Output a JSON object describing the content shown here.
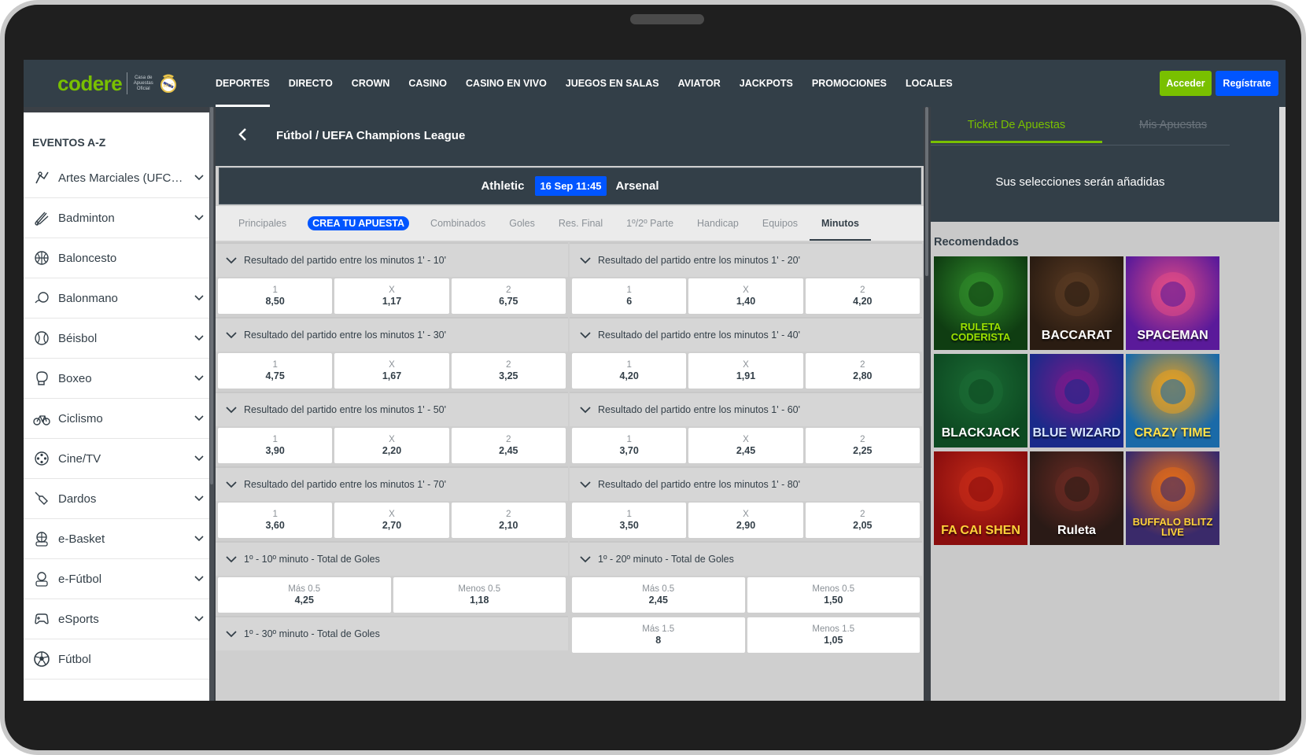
{
  "header": {
    "logo_text": "codere",
    "logo_tagline": "Casa de Apuestas Oficial",
    "nav": [
      {
        "label": "DEPORTES",
        "active": true
      },
      {
        "label": "DIRECTO"
      },
      {
        "label": "CROWN"
      },
      {
        "label": "CASINO"
      },
      {
        "label": "CASINO EN VIVO"
      },
      {
        "label": "JUEGOS EN SALAS"
      },
      {
        "label": "AVIATOR"
      },
      {
        "label": "JACKPOTS"
      },
      {
        "label": "PROMOCIONES"
      },
      {
        "label": "LOCALES"
      }
    ],
    "login_label": "Acceder",
    "register_label": "Regístrate"
  },
  "sidebar": {
    "title": "EVENTOS A-Z",
    "items": [
      {
        "label": "Artes Marciales (UFC/...",
        "icon": "martial-arts-icon"
      },
      {
        "label": "Badminton",
        "icon": "shuttlecock-icon"
      },
      {
        "label": "Baloncesto",
        "icon": "basketball-icon"
      },
      {
        "label": "Balonmano",
        "icon": "handball-icon"
      },
      {
        "label": "Béisbol",
        "icon": "baseball-icon"
      },
      {
        "label": "Boxeo",
        "icon": "boxing-glove-icon"
      },
      {
        "label": "Ciclismo",
        "icon": "bicycle-icon"
      },
      {
        "label": "Cine/TV",
        "icon": "film-reel-icon"
      },
      {
        "label": "Dardos",
        "icon": "dart-icon"
      },
      {
        "label": "e-Basket",
        "icon": "ebasket-icon"
      },
      {
        "label": "e-Fútbol",
        "icon": "efootball-icon"
      },
      {
        "label": "eSports",
        "icon": "gamepad-icon"
      },
      {
        "label": "Fútbol",
        "icon": "soccer-ball-icon"
      }
    ]
  },
  "event": {
    "breadcrumb": "Fútbol / UEFA Champions League",
    "home": "Athletic",
    "date": "16 Sep 11:45",
    "away": "Arsenal"
  },
  "tabs": [
    {
      "label": "Principales"
    },
    {
      "label": "CREA TU APUESTA",
      "pill": true
    },
    {
      "label": "Combinados"
    },
    {
      "label": "Goles"
    },
    {
      "label": "Res. Final"
    },
    {
      "label": "1º/2º Parte"
    },
    {
      "label": "Handicap"
    },
    {
      "label": "Equipos"
    },
    {
      "label": "Minutos",
      "active": true
    }
  ],
  "markets_left": [
    {
      "title": "Resultado del partido entre los minutos 1' - 10'",
      "odds": [
        [
          "1",
          "8,50"
        ],
        [
          "X",
          "1,17"
        ],
        [
          "2",
          "6,75"
        ]
      ]
    },
    {
      "title": "Resultado del partido entre los minutos 1' - 30'",
      "odds": [
        [
          "1",
          "4,75"
        ],
        [
          "X",
          "1,67"
        ],
        [
          "2",
          "3,25"
        ]
      ]
    },
    {
      "title": "Resultado del partido entre los minutos 1' - 50'",
      "odds": [
        [
          "1",
          "3,90"
        ],
        [
          "X",
          "2,20"
        ],
        [
          "2",
          "2,45"
        ]
      ]
    },
    {
      "title": "Resultado del partido entre los minutos 1' - 70'",
      "odds": [
        [
          "1",
          "3,60"
        ],
        [
          "X",
          "2,70"
        ],
        [
          "2",
          "2,10"
        ]
      ]
    },
    {
      "title": "1º - 10º minuto - Total de Goles",
      "odds": [
        [
          "Más 0.5",
          "4,25"
        ],
        [
          "Menos 0.5",
          "1,18"
        ]
      ]
    },
    {
      "title": "1º - 30º minuto - Total de Goles",
      "odds": []
    }
  ],
  "markets_right": [
    {
      "title": "Resultado del partido entre los minutos 1' - 20'",
      "odds": [
        [
          "1",
          "6"
        ],
        [
          "X",
          "1,40"
        ],
        [
          "2",
          "4,20"
        ]
      ]
    },
    {
      "title": "Resultado del partido entre los minutos 1' - 40'",
      "odds": [
        [
          "1",
          "4,20"
        ],
        [
          "X",
          "1,91"
        ],
        [
          "2",
          "2,80"
        ]
      ]
    },
    {
      "title": "Resultado del partido entre los minutos 1' - 60'",
      "odds": [
        [
          "1",
          "3,70"
        ],
        [
          "X",
          "2,45"
        ],
        [
          "2",
          "2,25"
        ]
      ]
    },
    {
      "title": "Resultado del partido entre los minutos 1' - 80'",
      "odds": [
        [
          "1",
          "3,50"
        ],
        [
          "X",
          "2,90"
        ],
        [
          "2",
          "2,05"
        ]
      ]
    },
    {
      "title": "1º - 20º minuto - Total de Goles",
      "odds": [
        [
          "Más 0.5",
          "2,45"
        ],
        [
          "Menos 0.5",
          "1,50"
        ]
      ],
      "odds2": [
        [
          "Más 1.5",
          "8"
        ],
        [
          "Menos 1.5",
          "1,05"
        ]
      ]
    }
  ],
  "ticket": {
    "tab_active": "Ticket De Apuestas",
    "tab_inactive": "Mis Apuestas",
    "empty_text": "Sus selecciones serán añadidas"
  },
  "recommended": {
    "title": "Recomendados",
    "games": [
      {
        "title": "RULETA CODERISTA",
        "bg": "#0f3d12",
        "accent": "#2f8a2a",
        "color": "#9be000"
      },
      {
        "title": "BACCARAT",
        "bg": "#2a1c12",
        "accent": "#5a3a22",
        "color": "#ffffff"
      },
      {
        "title": "SPACEMAN",
        "bg": "#5a1a9a",
        "accent": "#e04a86",
        "color": "#ffffff"
      },
      {
        "title": "BLACKJACK",
        "bg": "#0d4a22",
        "accent": "#1b6b34",
        "color": "#ffffff"
      },
      {
        "title": "BLUE WIZARD",
        "bg": "#1a2a8a",
        "accent": "#7a1a8a",
        "color": "#d6e4ff"
      },
      {
        "title": "CRAZY TIME",
        "bg": "#1a6aa8",
        "accent": "#e8a020",
        "color": "#ffe14a"
      },
      {
        "title": "FA CAI SHEN",
        "bg": "#8a0e0e",
        "accent": "#c42a18",
        "color": "#ffd23a"
      },
      {
        "title": "Ruleta",
        "bg": "#2a1a16",
        "accent": "#6a2a22",
        "color": "#ffffff"
      },
      {
        "title": "BUFFALO BLITZ LIVE",
        "bg": "#3a2a6a",
        "accent": "#e06a1a",
        "color": "#ffd23a"
      }
    ]
  }
}
